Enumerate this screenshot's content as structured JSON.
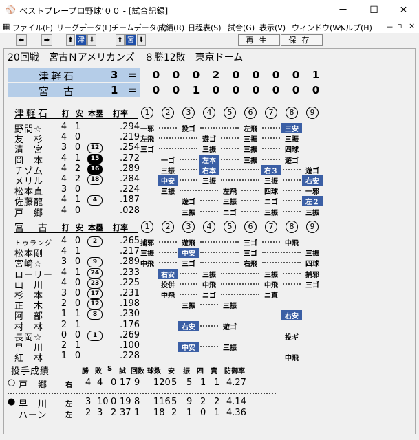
{
  "window": {
    "title": "ベストプレープロ野球'００ - [試合記録]",
    "buttons": [
      "－",
      "☐",
      "✕"
    ]
  },
  "menu": {
    "items": [
      "ファイル(F)",
      "リーグデータ(L)",
      "チームデータ(T)",
      "成績(R)",
      "日程表(S)",
      "試合(G)",
      "表示(V)",
      "ウィンドウ(W)",
      "ヘルプ(H)"
    ],
    "mdi": [
      "－",
      "▫",
      "×"
    ]
  },
  "toolbar": {
    "team_a": "津",
    "team_b": "宮",
    "replay": "再生",
    "save": "保存"
  },
  "game": {
    "header": "20回戦　宮古Ｎアメリカンズ　８勝12敗　東京ドーム",
    "away": {
      "name": "津軽石",
      "total": "3",
      "innings": [
        "0",
        "0",
        "0",
        "2",
        "0",
        "0",
        "0",
        "0",
        "1"
      ]
    },
    "home": {
      "name": "宮　古",
      "total": "1",
      "innings": [
        "0",
        "0",
        "1",
        "0",
        "0",
        "0",
        "0",
        "0",
        "0"
      ]
    }
  },
  "batting_headers": {
    "ab": "打",
    "h": "安",
    "hr": "本塁",
    "avg": "打率"
  },
  "innings_labels": [
    "1",
    "2",
    "3",
    "4",
    "5",
    "6",
    "7",
    "8",
    "9"
  ],
  "away_batting": {
    "team": "津軽石",
    "rows": [
      {
        "name": "野間☆",
        "ab": "4",
        "h": "1",
        "hr": "",
        "avg": ".294",
        "res": [
          {
            "i": 1,
            "t": "一邪"
          },
          {
            "i": 3,
            "t": "投ゴ"
          },
          {
            "i": 6,
            "t": "左飛"
          },
          {
            "i": 8,
            "t": "三安",
            "hl": true
          }
        ]
      },
      {
        "name": "友　杉",
        "ab": "4",
        "h": "0",
        "hr": "",
        "avg": ".219",
        "res": [
          {
            "i": 1,
            "t": "左飛"
          },
          {
            "i": 4,
            "t": "遊ゴ"
          },
          {
            "i": 6,
            "t": "三振"
          },
          {
            "i": 8,
            "t": "三振"
          }
        ]
      },
      {
        "name": "清　宮",
        "ab": "3",
        "h": "0",
        "hr": "12",
        "avg": ".254",
        "res": [
          {
            "i": 1,
            "t": "三ゴ"
          },
          {
            "i": 4,
            "t": "三振"
          },
          {
            "i": 6,
            "t": "三振"
          },
          {
            "i": 8,
            "t": "四球"
          }
        ]
      },
      {
        "name": "岡　本",
        "ab": "4",
        "h": "1",
        "hr": "15",
        "hrf": true,
        "avg": ".272",
        "res": [
          {
            "i": 2,
            "t": "一ゴ"
          },
          {
            "i": 4,
            "t": "左本",
            "hl": true
          },
          {
            "i": 6,
            "t": "三振"
          },
          {
            "i": 8,
            "t": "遊ゴ"
          }
        ]
      },
      {
        "name": "チゾム",
        "ab": "4",
        "h": "2",
        "hr": "16",
        "hrf": true,
        "avg": ".289",
        "res": [
          {
            "i": 2,
            "t": "三振"
          },
          {
            "i": 4,
            "t": "右本",
            "hl": true
          },
          {
            "i": 7,
            "t": "右３",
            "hl": true
          },
          {
            "i": 9,
            "t": "遊ゴ"
          }
        ]
      },
      {
        "name": "メリル",
        "ab": "4",
        "h": "2",
        "hr": "18",
        "avg": ".284",
        "res": [
          {
            "i": 2,
            "t": "中安",
            "hl": true
          },
          {
            "i": 4,
            "t": "三振"
          },
          {
            "i": 7,
            "t": "三振"
          },
          {
            "i": 9,
            "t": "右安",
            "hl": true
          }
        ]
      },
      {
        "name": "松本直",
        "ab": "3",
        "h": "0",
        "hr": "",
        "avg": ".224",
        "res": [
          {
            "i": 2,
            "t": "三振"
          },
          {
            "i": 5,
            "t": "左飛"
          },
          {
            "i": 7,
            "t": "四球"
          },
          {
            "i": 9,
            "t": "一邪"
          }
        ]
      },
      {
        "name": "佐藤龍",
        "ab": "4",
        "h": "1",
        "hr": "4",
        "avg": ".187",
        "res": [
          {
            "i": 3,
            "t": "遊ゴ"
          },
          {
            "i": 5,
            "t": "三振"
          },
          {
            "i": 7,
            "t": "ニゴ"
          },
          {
            "i": 9,
            "t": "左２",
            "hl": true
          }
        ]
      },
      {
        "name": "戸　郷",
        "ab": "4",
        "h": "0",
        "hr": "",
        "avg": ".028",
        "res": [
          {
            "i": 3,
            "t": "三振"
          },
          {
            "i": 5,
            "t": "ニゴ"
          },
          {
            "i": 7,
            "t": "三振"
          },
          {
            "i": 9,
            "t": "三振"
          }
        ]
      }
    ]
  },
  "home_batting": {
    "team": "宮　古",
    "rows": [
      {
        "name": "トゥラング",
        "ab": "4",
        "h": "0",
        "hr": "2",
        "avg": ".265",
        "small": true,
        "res": [
          {
            "i": 1,
            "t": "捕邪"
          },
          {
            "i": 3,
            "t": "遊飛"
          },
          {
            "i": 6,
            "t": "三ゴ"
          },
          {
            "i": 8,
            "t": "中飛"
          }
        ]
      },
      {
        "name": "松本剛",
        "ab": "4",
        "h": "1",
        "hr": "",
        "avg": ".217",
        "res": [
          {
            "i": 1,
            "t": "三振"
          },
          {
            "i": 3,
            "t": "中安",
            "hl": true
          },
          {
            "i": 6,
            "t": "三ゴ"
          },
          {
            "i": 9,
            "t": "三振"
          }
        ]
      },
      {
        "name": "宮崎☆",
        "ab": "3",
        "h": "0",
        "hr": "9",
        "avg": ".289",
        "res": [
          {
            "i": 1,
            "t": "中飛"
          },
          {
            "i": 3,
            "t": "三ゴ"
          },
          {
            "i": 6,
            "t": "右飛"
          },
          {
            "i": 9,
            "t": "四球"
          }
        ]
      },
      {
        "name": "ローリー",
        "ab": "4",
        "h": "1",
        "hr": "24",
        "avg": ".233",
        "res": [
          {
            "i": 2,
            "t": "右安",
            "hl": true
          },
          {
            "i": 4,
            "t": "三振"
          },
          {
            "i": 7,
            "t": "三振"
          },
          {
            "i": 9,
            "t": "捕邪"
          }
        ]
      },
      {
        "name": "山　川",
        "ab": "4",
        "h": "0",
        "hr": "23",
        "avg": ".225",
        "res": [
          {
            "i": 2,
            "t": "投併"
          },
          {
            "i": 4,
            "t": "中飛"
          },
          {
            "i": 7,
            "t": "中飛"
          },
          {
            "i": 9,
            "t": "三ゴ"
          }
        ]
      },
      {
        "name": "杉　本",
        "ab": "3",
        "h": "0",
        "hr": "17",
        "avg": ".231",
        "res": [
          {
            "i": 2,
            "t": "中飛"
          },
          {
            "i": 4,
            "t": "ニゴ"
          },
          {
            "i": 7,
            "t": "ニ直"
          }
        ]
      },
      {
        "name": "正　木",
        "ab": "2",
        "h": "0",
        "hr": "12",
        "avg": ".198",
        "res": [
          {
            "i": 3,
            "t": "三振"
          },
          {
            "i": 5,
            "t": "三振"
          }
        ]
      },
      {
        "name": "阿　部",
        "ab": "1",
        "h": "1",
        "hr": "8",
        "avg": ".230",
        "res": [
          {
            "i": 8,
            "t": "右安",
            "hl": true
          }
        ]
      },
      {
        "name": "村　林",
        "ab": "2",
        "h": "1",
        "hr": "",
        "avg": ".176",
        "res": [
          {
            "i": 3,
            "t": "右安",
            "hl": true
          },
          {
            "i": 5,
            "t": "遊ゴ"
          }
        ]
      },
      {
        "name": "長岡☆",
        "ab": "0",
        "h": "0",
        "hr": "1",
        "avg": ".269",
        "res": [
          {
            "i": 8,
            "t": "投ギ"
          }
        ]
      },
      {
        "name": "早　川",
        "ab": "2",
        "h": "1",
        "hr": "",
        "avg": ".100",
        "res": [
          {
            "i": 3,
            "t": "中安",
            "hl": true
          },
          {
            "i": 5,
            "t": "三振"
          }
        ]
      },
      {
        "name": "紅　林",
        "ab": "1",
        "h": "0",
        "hr": "",
        "avg": ".228",
        "res": [
          {
            "i": 8,
            "t": "中飛"
          }
        ]
      }
    ]
  },
  "pitching": {
    "title": "投手成績",
    "headers": [
      "勝",
      "敗",
      "S",
      "試",
      "回数",
      "球数",
      "安",
      "振",
      "四",
      "責",
      "防御率"
    ],
    "rows": [
      {
        "mark": "○",
        "name": "戸　郷",
        "hand": "右",
        "w": "4",
        "l": "4",
        "s": "0",
        "g": "17",
        "ip": "9",
        "np": "120",
        "h": "5",
        "so": "5",
        "bb": "1",
        "er": "1",
        "era": "4.27"
      },
      {
        "mark": "●",
        "name": "早　川",
        "hand": "左",
        "w": "3",
        "l": "10",
        "s": "0",
        "g": "19",
        "ip": "8",
        "np": "116",
        "h": "5",
        "so": "9",
        "bb": "2",
        "er": "2",
        "era": "4.14"
      },
      {
        "mark": "",
        "name": "ハーン",
        "hand": "左",
        "w": "2",
        "l": "3",
        "s": "2",
        "g": "37",
        "ip": "1",
        "np": "18",
        "h": "2",
        "so": "1",
        "bb": "0",
        "er": "1",
        "era": "4.36"
      }
    ]
  }
}
